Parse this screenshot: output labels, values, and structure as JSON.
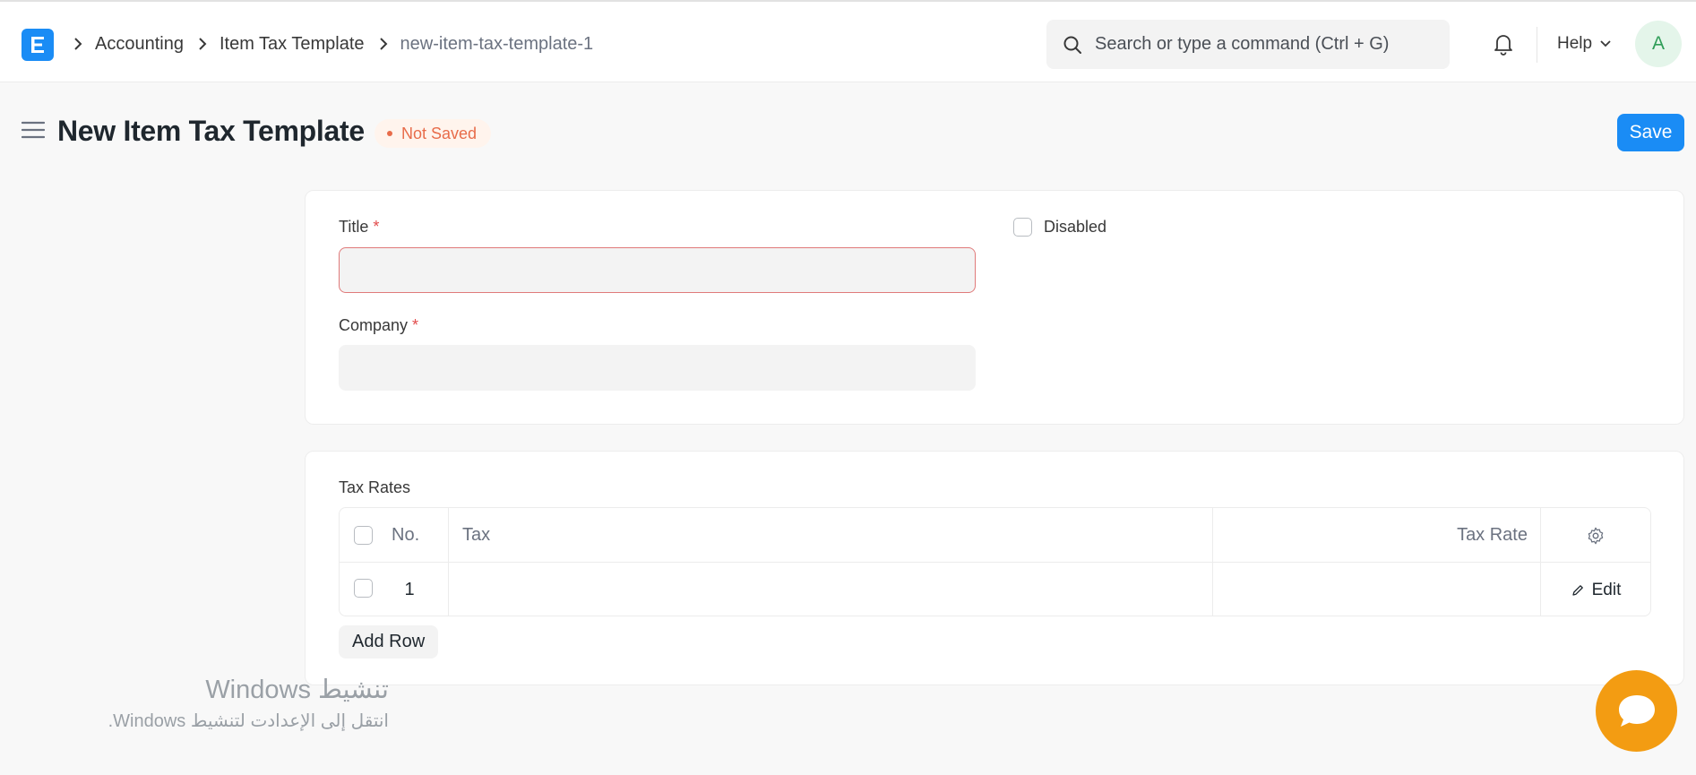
{
  "navbar": {
    "breadcrumbs": [
      "Accounting",
      "Item Tax Template",
      "new-item-tax-template-1"
    ],
    "search_placeholder": "Search or type a command (Ctrl + G)",
    "help_label": "Help",
    "avatar_initial": "A"
  },
  "page": {
    "title": "New Item Tax Template",
    "status": "Not Saved",
    "save_label": "Save"
  },
  "form": {
    "title_label": "Title",
    "title_value": "",
    "company_label": "Company",
    "company_value": "",
    "required_mark": "*",
    "disabled_label": "Disabled",
    "disabled_checked": false
  },
  "tax_rates": {
    "section_label": "Tax Rates",
    "columns": [
      "No.",
      "Tax",
      "Tax Rate"
    ],
    "rows": [
      {
        "no": "1",
        "tax": "",
        "tax_rate": "",
        "action": "Edit"
      }
    ],
    "add_row_label": "Add Row"
  },
  "watermark": {
    "title": "تنشيط Windows",
    "subtitle": "انتقل إلى الإعدادت لتنشيط Windows."
  },
  "colors": {
    "primary": "#1a8cf5",
    "warning": "#e86c4a",
    "chat": "#f39c12"
  }
}
